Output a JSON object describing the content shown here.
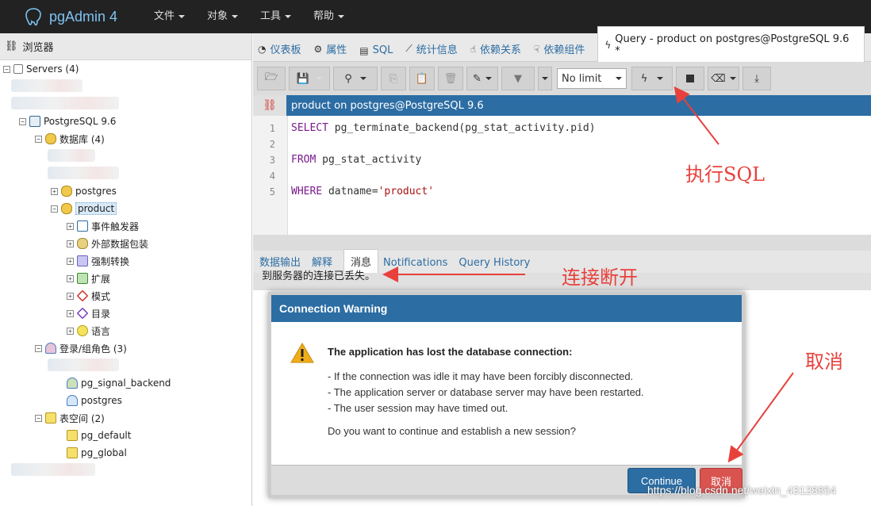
{
  "app": {
    "title": "pgAdmin 4"
  },
  "menu": [
    {
      "label": "文件"
    },
    {
      "label": "对象"
    },
    {
      "label": "工具"
    },
    {
      "label": "帮助"
    }
  ],
  "browser": {
    "title": "浏览器",
    "nodes": {
      "servers": "Servers (4)",
      "pg96": "PostgreSQL 9.6",
      "databases": "数据库 (4)",
      "postgres_db": "postgres",
      "product_db": "product",
      "event_triggers": "事件触发器",
      "fdw": "外部数据包装",
      "casts": "强制转换",
      "extensions": "扩展",
      "schemas": "模式",
      "catalogs": "目录",
      "languages": "语言",
      "login_roles": "登录/组角色 (3)",
      "pg_signal_backend": "pg_signal_backend",
      "postgres_role": "postgres",
      "tablespaces": "表空间 (2)",
      "pg_default": "pg_default",
      "pg_global": "pg_global"
    }
  },
  "tabs": [
    {
      "label": "仪表板",
      "icon": "dashboard-icon"
    },
    {
      "label": "属性",
      "icon": "properties-icon"
    },
    {
      "label": "SQL",
      "icon": "sql-icon"
    },
    {
      "label": "统计信息",
      "icon": "stats-icon"
    },
    {
      "label": "依赖关系",
      "icon": "dependencies-icon"
    },
    {
      "label": "依赖组件",
      "icon": "dependents-icon"
    },
    {
      "label": "Query - product on postgres@PostgreSQL 9.6 *",
      "icon": "query-icon"
    }
  ],
  "toolbar": {
    "limit": "No limit"
  },
  "editor": {
    "connection": "product on postgres@PostgreSQL 9.6",
    "lines": [
      "1",
      "2",
      "3",
      "4",
      "5"
    ],
    "code": {
      "l1_kw": "SELECT",
      "l1_rest": " pg_terminate_backend(pg_stat_activity.pid)",
      "l3_kw": "FROM",
      "l3_rest": " pg_stat_activity",
      "l5_kw": "WHERE",
      "l5_mid": " datname=",
      "l5_str": "'product'"
    }
  },
  "output_tabs": [
    {
      "label": "数据输出"
    },
    {
      "label": "解释"
    },
    {
      "label": "消息"
    },
    {
      "label": "Notifications"
    },
    {
      "label": "Query History"
    }
  ],
  "message": "到服务器的连接已丢失。",
  "dialog": {
    "title": "Connection Warning",
    "heading": "The application has lost the database connection:",
    "reasons": [
      "- If the connection was idle it may have been forcibly disconnected.",
      "- The application server or database server may have been restarted.",
      "- The user session may have timed out."
    ],
    "question": "Do you want to continue and establish a new session?",
    "continue_label": "Continue",
    "cancel_label": "取消"
  },
  "annotations": {
    "execute": "执行SQL",
    "disconnect": "连接断开",
    "cancel": "取消"
  },
  "watermark": "https://blog.csdn.net/weixin_43128854",
  "colors": {
    "accent": "#2c6da3",
    "danger": "#d9534f",
    "annotation": "#e8413c",
    "navbar": "#222222"
  }
}
